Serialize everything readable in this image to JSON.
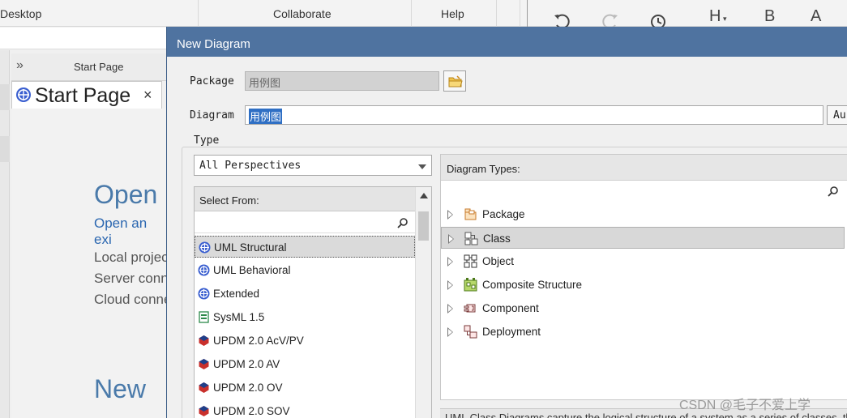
{
  "ribbon": {
    "tabs": [
      "Desktop",
      "Collaborate",
      "Help"
    ]
  },
  "format_toolbar": {
    "bold": "B",
    "heading": "H",
    "font_color": "A"
  },
  "start_page": {
    "panel_title": "Start Page",
    "tab_label": "Start Page",
    "close": "×",
    "open_heading": "Open",
    "open_link": "Open an exi",
    "local": "Local projec",
    "server": "Server conn",
    "cloud": "Cloud conne",
    "new_heading": "New"
  },
  "dialog": {
    "title": "New Diagram",
    "package_label": "Package",
    "package_value": "用例图",
    "diagram_label": "Diagram",
    "diagram_value": "用例图",
    "auto_label": "Au",
    "type_label": "Type",
    "perspective": "All Perspectives",
    "select_from": {
      "header": "Select From:",
      "items": [
        {
          "label": "UML Structural",
          "icon": "uml-icon",
          "selected": true
        },
        {
          "label": "UML Behavioral",
          "icon": "uml-icon",
          "selected": false
        },
        {
          "label": "Extended",
          "icon": "uml-icon",
          "selected": false
        },
        {
          "label": "SysML 1.5",
          "icon": "sysml-icon",
          "selected": false
        },
        {
          "label": "UPDM 2.0 AcV/PV",
          "icon": "updm-icon",
          "selected": false
        },
        {
          "label": "UPDM 2.0 AV",
          "icon": "updm-icon",
          "selected": false
        },
        {
          "label": "UPDM 2.0 OV",
          "icon": "updm-icon",
          "selected": false
        },
        {
          "label": "UPDM 2.0 SOV",
          "icon": "updm-icon",
          "selected": false
        }
      ]
    },
    "diagram_types": {
      "header": "Diagram Types:",
      "items": [
        {
          "label": "Package",
          "icon": "package-diagram-icon",
          "selected": false
        },
        {
          "label": "Class",
          "icon": "class-diagram-icon",
          "selected": true
        },
        {
          "label": "Object",
          "icon": "object-diagram-icon",
          "selected": false
        },
        {
          "label": "Composite Structure",
          "icon": "composite-structure-icon",
          "selected": false
        },
        {
          "label": "Component",
          "icon": "component-diagram-icon",
          "selected": false
        },
        {
          "label": "Deployment",
          "icon": "deployment-diagram-icon",
          "selected": false
        }
      ]
    },
    "description": "UML Class Diagrams capture the logical structure of a system as a series of classes, tha"
  },
  "watermark": "CSDN @毛子不爱上学",
  "colors": {
    "title_bar": "#4f73a0",
    "selection": "#2f6fc4",
    "link": "#2a66b0"
  }
}
